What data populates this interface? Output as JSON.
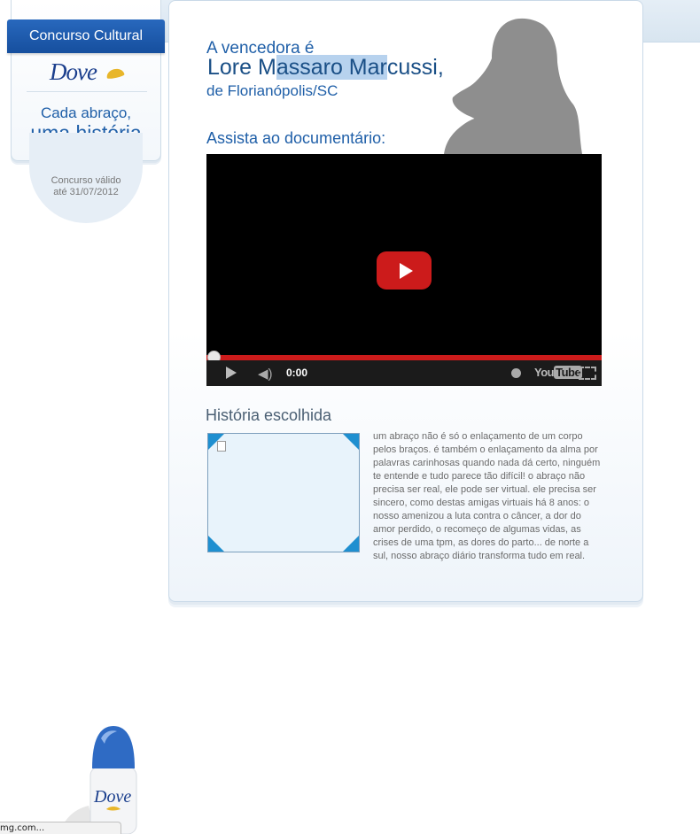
{
  "sidebar": {
    "tab_label": "Concurso Cultural",
    "brand": "Dove",
    "tagline_line1": "Cada abraço,",
    "tagline_line2": "uma história",
    "validity_line1": "Concurso válido",
    "validity_line2": "até 31/07/2012"
  },
  "winner": {
    "label": "A vencedora é",
    "name_part1": "Lore M",
    "name_highlight": "assaro Mar",
    "name_part2": "cussi,",
    "city": "de Florianópolis/SC"
  },
  "documentary": {
    "label": "Assista ao documentário:",
    "player": {
      "time": "0:00",
      "brand_you": "You",
      "brand_tube": "Tube",
      "progress": 0
    }
  },
  "story": {
    "heading": "História escolhida",
    "text": "um abraço não é só o enlaçamento de um corpo pelos braços. é também o enlaçamento da alma por palavras carinhosas quando nada dá certo, ninguém te entende e tudo parece tão difícil! o abraço não precisa ser real, ele pode ser virtual. ele precisa ser sincero, como destas amigas virtuais há 8 anos: o nosso amenizou a luta contra o câncer, a dor do amor perdido, o recomeço de algumas vidas, as crises de uma tpm, as dores do parto... de norte a sul, nosso abraço diário transforma tudo em real."
  },
  "product": {
    "brand": "Dove"
  },
  "status_bar": {
    "text": "mg.com..."
  },
  "colors": {
    "brand_blue": "#164f9e",
    "title_blue": "#1a4f86",
    "youtube_red": "#cc1b1b",
    "frame_accent": "#1f8fd0"
  }
}
